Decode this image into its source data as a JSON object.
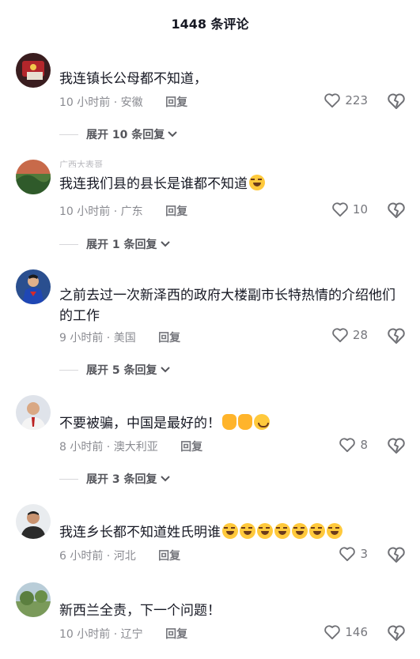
{
  "header": {
    "title": "1448 条评论"
  },
  "comments": [
    {
      "username": "",
      "text": "我连镇长公母都不知道，",
      "time": "10 小时前",
      "location": "安徽",
      "reply_label": "回复",
      "likes": "223",
      "expand_label": "展开 10 条回复"
    },
    {
      "username": "广西大表哥",
      "text": "我连我们县的县长是谁都不知道",
      "time": "10 小时前",
      "location": "广东",
      "reply_label": "回复",
      "likes": "10",
      "expand_label": "展开 1 条回复"
    },
    {
      "username": "",
      "text": "之前去过一次新泽西的政府大楼副市长特热情的介绍他们的工作",
      "time": "9 小时前",
      "location": "美国",
      "reply_label": "回复",
      "likes": "28",
      "expand_label": "展开 5 条回复"
    },
    {
      "username": "",
      "text": "不要被骗，中国是最好的！",
      "time": "8 小时前",
      "location": "澳大利亚",
      "reply_label": "回复",
      "likes": "8",
      "expand_label": "展开 3 条回复"
    },
    {
      "username": "",
      "text": "我连乡长都不知道姓氏明谁",
      "time": "6 小时前",
      "location": "河北",
      "reply_label": "回复",
      "likes": "3",
      "expand_label": ""
    },
    {
      "username": "",
      "text": "新西兰全责，下一个问题！",
      "time": "10 小时前",
      "location": "辽宁",
      "reply_label": "回复",
      "likes": "146",
      "expand_label": ""
    }
  ],
  "icons": {
    "like": "heart-outline-icon",
    "dislike": "broken-heart-icon",
    "expand": "chevron-down-icon"
  }
}
